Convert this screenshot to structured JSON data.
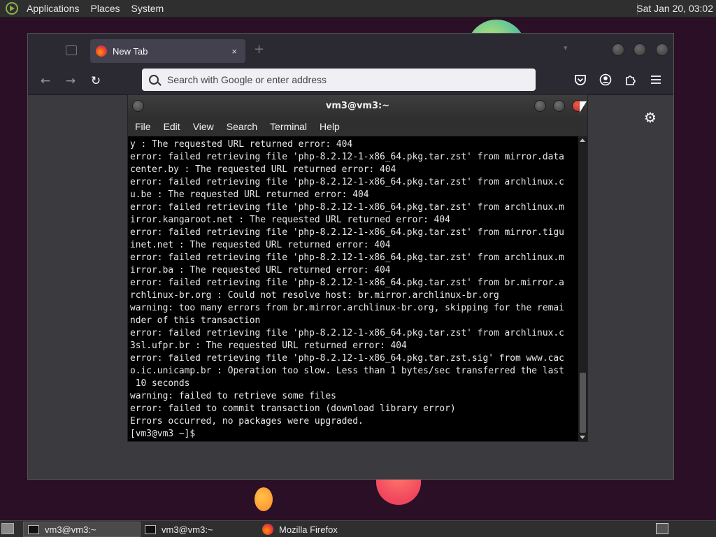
{
  "top_panel": {
    "menus": [
      "Applications",
      "Places",
      "System"
    ],
    "clock": "Sat Jan 20, 03:02"
  },
  "firefox": {
    "tab_title": "New Tab",
    "tab_close": "×",
    "new_tab": "+",
    "url_placeholder": "Search with Google or enter address",
    "icons": [
      "back-arrow-icon",
      "forward-arrow-icon",
      "reload-icon",
      "pocket-icon",
      "account-icon",
      "extensions-icon",
      "menu-icon",
      "settings-gear-icon"
    ]
  },
  "terminal": {
    "title": "vm3@vm3:~",
    "menu": [
      "File",
      "Edit",
      "View",
      "Search",
      "Terminal",
      "Help"
    ],
    "lines": [
      "y : The requested URL returned error: 404",
      "error: failed retrieving file 'php-8.2.12-1-x86_64.pkg.tar.zst' from mirror.data",
      "center.by : The requested URL returned error: 404",
      "error: failed retrieving file 'php-8.2.12-1-x86_64.pkg.tar.zst' from archlinux.c",
      "u.be : The requested URL returned error: 404",
      "error: failed retrieving file 'php-8.2.12-1-x86_64.pkg.tar.zst' from archlinux.m",
      "irror.kangaroot.net : The requested URL returned error: 404",
      "error: failed retrieving file 'php-8.2.12-1-x86_64.pkg.tar.zst' from mirror.tigu",
      "inet.net : The requested URL returned error: 404",
      "error: failed retrieving file 'php-8.2.12-1-x86_64.pkg.tar.zst' from archlinux.m",
      "irror.ba : The requested URL returned error: 404",
      "error: failed retrieving file 'php-8.2.12-1-x86_64.pkg.tar.zst' from br.mirror.a",
      "rchlinux-br.org : Could not resolve host: br.mirror.archlinux-br.org",
      "warning: too many errors from br.mirror.archlinux-br.org, skipping for the remai",
      "nder of this transaction",
      "error: failed retrieving file 'php-8.2.12-1-x86_64.pkg.tar.zst' from archlinux.c",
      "3sl.ufpr.br : The requested URL returned error: 404",
      "error: failed retrieving file 'php-8.2.12-1-x86_64.pkg.tar.zst.sig' from www.cac",
      "o.ic.unicamp.br : Operation too slow. Less than 1 bytes/sec transferred the last",
      " 10 seconds",
      "warning: failed to retrieve some files",
      "error: failed to commit transaction (download library error)",
      "Errors occurred, no packages were upgraded.",
      "[vm3@vm3 ~]$ "
    ]
  },
  "taskbar": {
    "tasks": [
      "vm3@vm3:~",
      "vm3@vm3:~",
      "Mozilla Firefox"
    ]
  }
}
